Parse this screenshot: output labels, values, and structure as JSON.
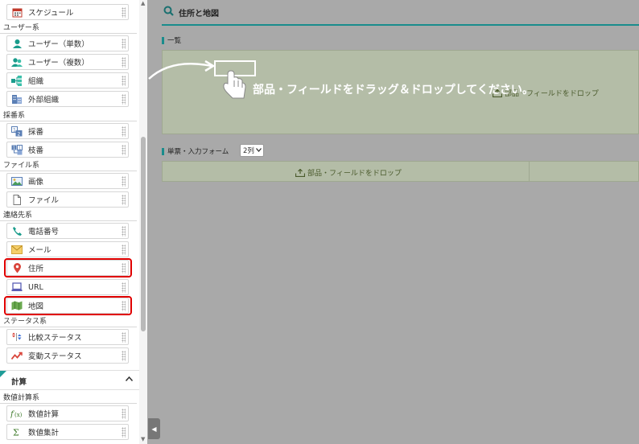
{
  "sidebar": {
    "categories": [
      {
        "label": "ユーザー系"
      },
      {
        "label": "採番系"
      },
      {
        "label": "ファイル系"
      },
      {
        "label": "連絡先系"
      },
      {
        "label": "ステータス系"
      },
      {
        "label": "数値計算系"
      }
    ],
    "items": [
      {
        "label": "スケジュール",
        "icon": "calendar-icon"
      },
      {
        "label": "ユーザー（単数）",
        "icon": "user-icon"
      },
      {
        "label": "ユーザー（複数）",
        "icon": "users-icon"
      },
      {
        "label": "組織",
        "icon": "org-icon"
      },
      {
        "label": "外部組織",
        "icon": "building-icon"
      },
      {
        "label": "採番",
        "icon": "numbering-icon"
      },
      {
        "label": "枝番",
        "icon": "branch-number-icon"
      },
      {
        "label": "画像",
        "icon": "image-icon"
      },
      {
        "label": "ファイル",
        "icon": "file-icon"
      },
      {
        "label": "電話番号",
        "icon": "phone-icon"
      },
      {
        "label": "メール",
        "icon": "mail-icon"
      },
      {
        "label": "住所",
        "icon": "location-pin-icon"
      },
      {
        "label": "URL",
        "icon": "laptop-icon"
      },
      {
        "label": "地図",
        "icon": "map-icon"
      },
      {
        "label": "比較ステータス",
        "icon": "compare-status-icon"
      },
      {
        "label": "変動ステータス",
        "icon": "trend-icon"
      },
      {
        "label": "数値計算",
        "icon": "function-icon"
      },
      {
        "label": "数値集計",
        "icon": "sum-icon"
      }
    ],
    "calc_section": {
      "title": "計算",
      "chevron": "chevron-up-icon"
    }
  },
  "main": {
    "header_title": "住所と地図",
    "list_label": "一覧",
    "form_label": "単票・入力フォーム",
    "column_select": "2列",
    "drop_text": "部品・フィールドをドロップ",
    "instruction": "部品・フィールドをドラッグ＆ドロップしてください。"
  },
  "colors": {
    "accent": "#1a8c8c",
    "highlight": "#e00000",
    "dropzone": "#b4bda7"
  }
}
